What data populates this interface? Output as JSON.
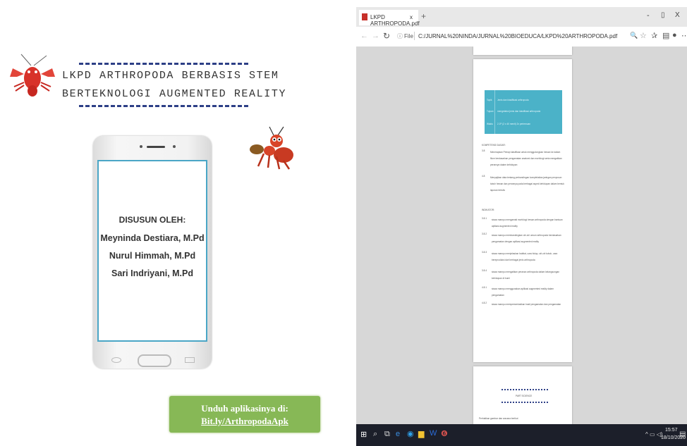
{
  "cover": {
    "title_line1": "LKPD ARTHROPODA BERBASIS STEM",
    "title_line2": "BERTEKNOLOGI AUGMENTED REALITY",
    "compiled_by": "DISUSUN OLEH:",
    "authors": [
      "Meyninda Destiara, M.Pd",
      "Nurul Himmah, M.Pd",
      "Sari Indriyani, M.Pd"
    ],
    "download_line1": "Unduh aplikasinya di:",
    "download_line2": "Bit.ly/ArthropodaApk"
  },
  "browser": {
    "tab_title": "LKPD ARTHROPODA.pdf",
    "tab_close": "x",
    "new_tab": "+",
    "window_min": "-",
    "window_max": "▯",
    "window_close": "X",
    "file_label": "File",
    "url": "C:/JURNAL%20NINDA/JURNAL%20BIOEDUCA/LKPD%20ARTHROPODA.pdf"
  },
  "pdf": {
    "table_rows": [
      {
        "label": "Topik",
        "value": "Jenis dan klasifikasi arthropoda"
      },
      {
        "label": "Tujuan",
        "value": "mengetahui jenis dan klasifikasi arthropoda"
      },
      {
        "label": "Waktu",
        "value": "2 JP (2 x 40 menit) 2x pertemuan"
      }
    ],
    "kd_heading": "KOMPETENSI DASAR:",
    "kd_items": [
      {
        "num": "3.8",
        "text": "Menerapkan Prinsip klasifikasi untuk menggolongkan hewan ke dalam filum berdasarkan pengamatan anatomi dan morfologi serta mengaitkan perannya dalam kehidupan"
      },
      {
        "num": "4.8",
        "text": "Menyajikan data tentang perbandingan kompleksitas jaringan penyusun tubuh hewan dan perannya pada berbagai aspek kehidupan dalam bentuk laporan tertulis"
      }
    ],
    "ind_heading": "INDIKATOR:",
    "ind_items": [
      {
        "num": "3.8.1",
        "text": "siswa mampu mengamati morfologi hewan arthropoda dengan bantuan aplikasi augmented reality"
      },
      {
        "num": "3.8.2",
        "text": "siswa mampu membandingkan ciri-ciri umum arthropoda berdasarkan pengamatan dengan aplikasi augmented reality"
      },
      {
        "num": "3.8.3",
        "text": "siswa mampu menjelaskan habitat, cara hidup, ciri-ciri tubuh, cara bereproduksi dari berbagai jenis arthropoda"
      },
      {
        "num": "3.8.4",
        "text": "siswa mampu mengaitkan peranan arthropoda dalam kelangsungan kehidupan di bumi"
      },
      {
        "num": "4.8.1",
        "text": "siswa mampu menggunakan aplikasi augmented reality dalam pengamatan"
      },
      {
        "num": "4.8.2",
        "text": "siswa mampu mempresentasikan hasil pengamatan dan pengamatan"
      }
    ],
    "page3_heading": "PART SCIENCE",
    "page3_text": "Perhatikan gambar dan wacana berikut"
  },
  "taskbar": {
    "time": "15:57",
    "date": "18/10/2020"
  },
  "colors": {
    "table_fill": "#4bb2c8",
    "download_green": "#87b856",
    "dash_blue": "#2d3f86"
  }
}
